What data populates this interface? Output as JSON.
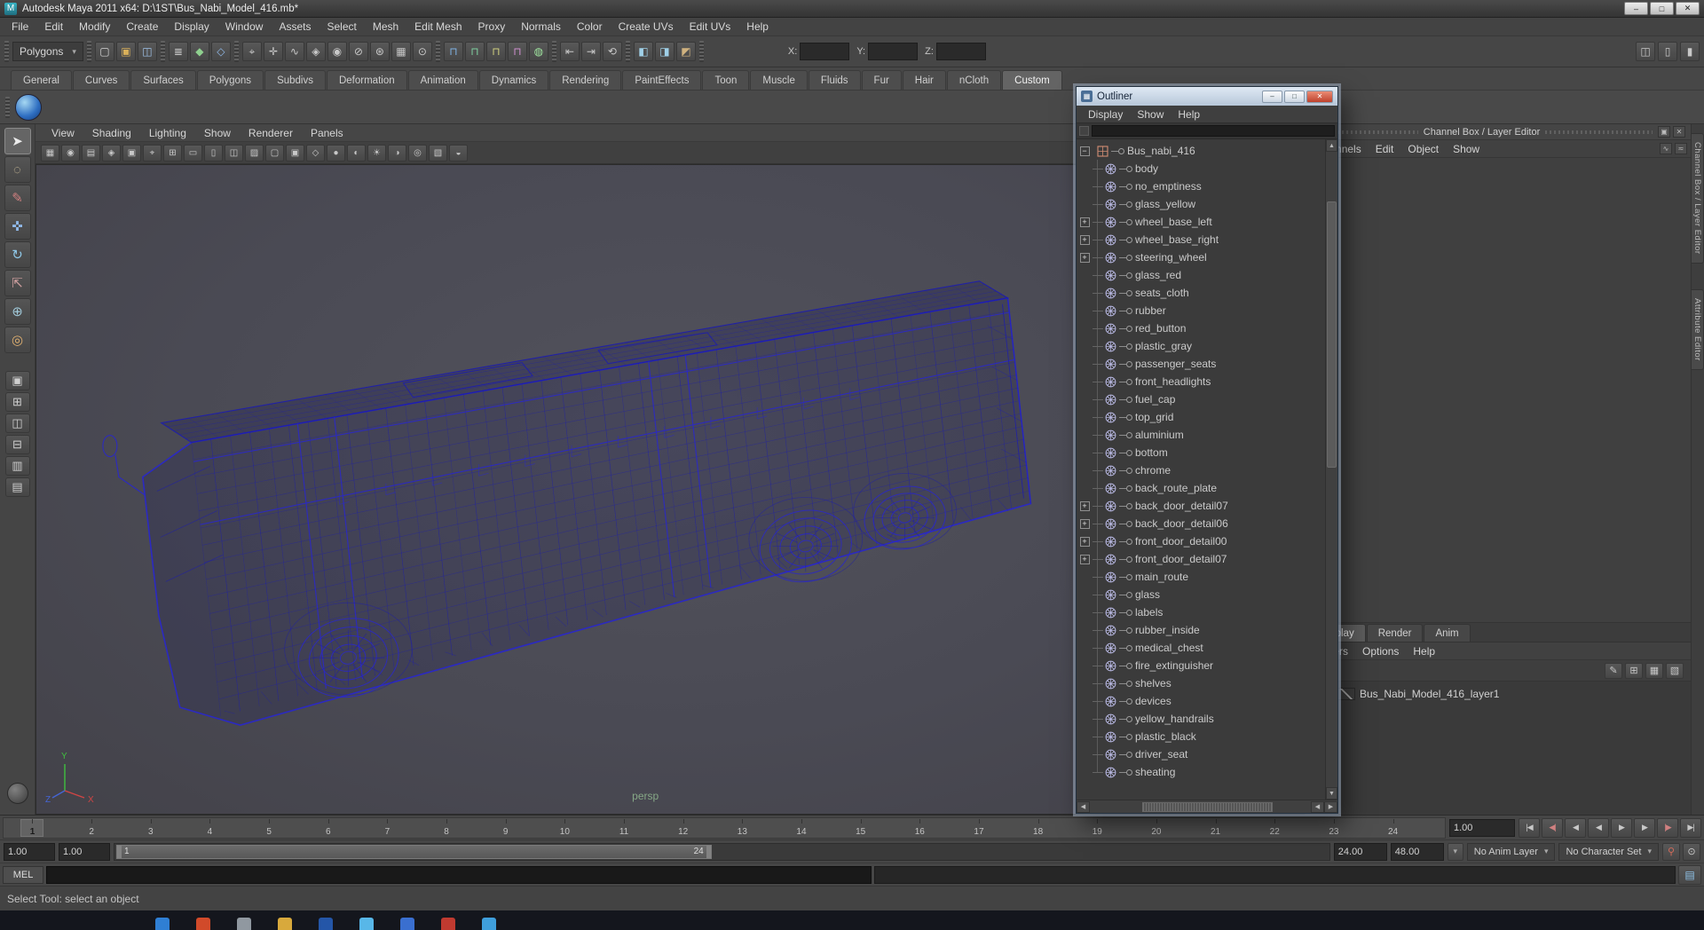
{
  "colors": {
    "wireframe": "#1c1cae",
    "wireframe_bright": "#2a28c8",
    "viewport_bg_center": "#52525c",
    "viewport_bg_edge": "#434249",
    "persp_label_color": "#86a886",
    "axis_x": "#d04545",
    "axis_y": "#3fbf3f",
    "axis_z": "#4565d5",
    "outliner_close_red": "#bf422d"
  },
  "ui": {
    "caret_glyph": "▾"
  },
  "window": {
    "title": "Autodesk Maya 2011 x64: D:\\1ST\\Bus_Nabi_Model_416.mb*",
    "icon_glyph": "M",
    "buttons": [
      {
        "name": "minimize-button",
        "glyph": "–"
      },
      {
        "name": "maximize-button",
        "glyph": "□"
      },
      {
        "name": "close-button",
        "glyph": "✕"
      }
    ]
  },
  "menubar": {
    "items": [
      "File",
      "Edit",
      "Modify",
      "Create",
      "Display",
      "Window",
      "Assets",
      "Select",
      "Mesh",
      "Edit Mesh",
      "Proxy",
      "Normals",
      "Color",
      "Create UVs",
      "Edit UVs",
      "Help"
    ]
  },
  "statusline": {
    "menuset": {
      "value": "Polygons"
    },
    "groups": [
      {
        "name": "file-group",
        "icons": [
          {
            "name": "new-scene-icon",
            "glyph": "▢",
            "color": "#d5d5d5"
          },
          {
            "name": "open-scene-icon",
            "glyph": "▣",
            "color": "#d9b05a"
          },
          {
            "name": "save-scene-icon",
            "glyph": "◫",
            "color": "#9fc2e8"
          }
        ]
      },
      {
        "name": "selection-mode-group",
        "icons": [
          {
            "name": "select-hierarchy-icon",
            "glyph": "≣",
            "color": "#cfcfcf"
          },
          {
            "name": "select-object-icon",
            "glyph": "◆",
            "color": "#8fd08f"
          },
          {
            "name": "select-component-icon",
            "glyph": "◇",
            "color": "#8fb8e8"
          }
        ]
      },
      {
        "name": "selection-mask-group",
        "icons": [
          {
            "name": "select-points-icon",
            "glyph": "⌖"
          },
          {
            "name": "select-handles-icon",
            "glyph": "✛"
          },
          {
            "name": "select-curves-icon",
            "glyph": "∿"
          },
          {
            "name": "select-surfaces-icon",
            "glyph": "◈"
          },
          {
            "name": "select-deformations-icon",
            "glyph": "◉"
          },
          {
            "name": "select-joints-icon",
            "glyph": "⊘"
          },
          {
            "name": "select-dynamics-icon",
            "glyph": "⊛"
          },
          {
            "name": "select-rendering-icon",
            "glyph": "▦"
          },
          {
            "name": "select-misc-icon",
            "glyph": "⊙"
          }
        ]
      },
      {
        "name": "snap-group",
        "icons": [
          {
            "name": "snap-grid-icon",
            "glyph": "⊓",
            "color": "#7fb2e5"
          },
          {
            "name": "snap-curve-icon",
            "glyph": "⊓",
            "color": "#7fd0a0"
          },
          {
            "name": "snap-point-icon",
            "glyph": "⊓",
            "color": "#d0d07f"
          },
          {
            "name": "snap-plane-icon",
            "glyph": "⊓",
            "color": "#d08fd0"
          },
          {
            "name": "make-live-icon",
            "glyph": "◍",
            "color": "#9fe59f"
          }
        ]
      },
      {
        "name": "history-group",
        "icons": [
          {
            "name": "input-connections-icon",
            "glyph": "⇤"
          },
          {
            "name": "output-connections-icon",
            "glyph": "⇥"
          },
          {
            "name": "construction-history-icon",
            "glyph": "⟲"
          }
        ]
      },
      {
        "name": "render-group",
        "icons": [
          {
            "name": "render-current-frame-icon",
            "glyph": "◧",
            "color": "#9fd0e8"
          },
          {
            "name": "ipr-render-icon",
            "glyph": "◨",
            "color": "#9fd0e8"
          },
          {
            "name": "render-settings-icon",
            "glyph": "◩",
            "color": "#d0b27f"
          }
        ]
      }
    ],
    "xyz": {
      "x_label": "X:",
      "y_label": "Y:",
      "z_label": "Z:",
      "x_value": "",
      "y_value": "",
      "z_value": ""
    },
    "right_icons": [
      {
        "name": "toggle-attribute-editor-icon",
        "glyph": "◫"
      },
      {
        "name": "toggle-tool-settings-icon",
        "glyph": "▯"
      },
      {
        "name": "toggle-channel-box-icon",
        "glyph": "▮"
      }
    ]
  },
  "shelf": {
    "tabs": [
      "General",
      "Curves",
      "Surfaces",
      "Polygons",
      "Subdivs",
      "Deformation",
      "Animation",
      "Dynamics",
      "Rendering",
      "PaintEffects",
      "Toon",
      "Muscle",
      "Fluids",
      "Fur",
      "Hair",
      "nCloth",
      "Custom"
    ],
    "active_tab": "Custom",
    "items": [
      {
        "name": "custom-shelf-script-button"
      }
    ]
  },
  "toolbox": {
    "tools": [
      {
        "name": "select-tool",
        "glyph": "➤",
        "color": "#ececec",
        "active": true
      },
      {
        "name": "lasso-select-tool",
        "glyph": "◌",
        "color": "#d8c8a0"
      },
      {
        "name": "paint-select-tool",
        "glyph": "✎",
        "color": "#d08080"
      },
      {
        "name": "move-tool",
        "glyph": "✜",
        "color": "#8fb8e8"
      },
      {
        "name": "rotate-tool",
        "glyph": "↻",
        "color": "#8fc8e8"
      },
      {
        "name": "scale-tool",
        "glyph": "⇱",
        "color": "#d0a0a0"
      },
      {
        "name": "universal-manipulator-tool",
        "glyph": "⊕",
        "color": "#a0c8d8"
      },
      {
        "name": "soft-modification-tool",
        "glyph": "◎",
        "color": "#e0b070"
      }
    ],
    "layouts": [
      {
        "name": "layout-single-persp",
        "glyph": "▣"
      },
      {
        "name": "layout-four-view",
        "glyph": "⊞"
      },
      {
        "name": "layout-persp-outliner",
        "glyph": "◫"
      },
      {
        "name": "layout-persp-graph",
        "glyph": "⊟"
      },
      {
        "name": "layout-hypershade-persp",
        "glyph": "▥"
      },
      {
        "name": "layout-persp-side",
        "glyph": "▤"
      }
    ]
  },
  "panel": {
    "menus": [
      "View",
      "Shading",
      "Lighting",
      "Show",
      "Renderer",
      "Panels"
    ],
    "toolbar_icons": [
      {
        "name": "select-camera-icon",
        "glyph": "▦"
      },
      {
        "name": "lock-camera-icon",
        "glyph": "◉"
      },
      {
        "name": "camera-attributes-icon",
        "glyph": "▤"
      },
      {
        "name": "bookmark-icon",
        "glyph": "◈"
      },
      {
        "name": "image-plane-icon",
        "glyph": "▣"
      },
      {
        "name": "2d-pan-zoom-icon",
        "glyph": "⌖"
      },
      {
        "name": "grid-toggle-icon",
        "glyph": "⊞"
      },
      {
        "name": "film-gate-icon",
        "glyph": "▭"
      },
      {
        "name": "resolution-gate-icon",
        "glyph": "▯"
      },
      {
        "name": "gate-mask-icon",
        "glyph": "◫"
      },
      {
        "name": "field-chart-icon",
        "glyph": "▨"
      },
      {
        "name": "safe-action-icon",
        "glyph": "▢"
      },
      {
        "name": "safe-title-icon",
        "glyph": "▣"
      },
      {
        "name": "wireframe-display-icon",
        "glyph": "◇"
      },
      {
        "name": "smooth-shade-icon",
        "glyph": "●"
      },
      {
        "name": "textured-display-icon",
        "glyph": "◐"
      },
      {
        "name": "lights-icon",
        "glyph": "☀"
      },
      {
        "name": "shadows-icon",
        "glyph": "◑"
      },
      {
        "name": "isolate-select-icon",
        "glyph": "◎"
      },
      {
        "name": "xray-icon",
        "glyph": "▧"
      },
      {
        "name": "exposure-icon",
        "glyph": "◒"
      }
    ],
    "camera_label": "persp",
    "axis_labels": {
      "x": "X",
      "y": "Y",
      "z": "Z"
    }
  },
  "outliner": {
    "title": "Outliner",
    "window_buttons": [
      {
        "name": "outliner-minimize-button",
        "glyph": "–"
      },
      {
        "name": "outliner-maximize-button",
        "glyph": "□"
      },
      {
        "name": "outliner-close-button",
        "glyph": "✕",
        "close": true
      }
    ],
    "menus": [
      "Display",
      "Show",
      "Help"
    ],
    "filter_value": "",
    "scroll_glyphs": {
      "up": "▲",
      "down": "▼",
      "left": "◀",
      "right": "▶"
    },
    "items": [
      {
        "label": "Bus_nabi_416",
        "type": "group",
        "expand": "minus"
      },
      {
        "label": "body",
        "type": "mesh"
      },
      {
        "label": "no_emptiness",
        "type": "mesh"
      },
      {
        "label": "glass_yellow",
        "type": "mesh"
      },
      {
        "label": "wheel_base_left",
        "type": "mesh",
        "expand": "plus"
      },
      {
        "label": "wheel_base_right",
        "type": "mesh",
        "expand": "plus"
      },
      {
        "label": "steering_wheel",
        "type": "mesh",
        "expand": "plus"
      },
      {
        "label": "glass_red",
        "type": "mesh"
      },
      {
        "label": "seats_cloth",
        "type": "mesh"
      },
      {
        "label": "rubber",
        "type": "mesh"
      },
      {
        "label": "red_button",
        "type": "mesh"
      },
      {
        "label": "plastic_gray",
        "type": "mesh"
      },
      {
        "label": "passenger_seats",
        "type": "mesh"
      },
      {
        "label": "front_headlights",
        "type": "mesh"
      },
      {
        "label": "fuel_cap",
        "type": "mesh"
      },
      {
        "label": "top_grid",
        "type": "mesh"
      },
      {
        "label": "aluminium",
        "type": "mesh"
      },
      {
        "label": "bottom",
        "type": "mesh"
      },
      {
        "label": "chrome",
        "type": "mesh"
      },
      {
        "label": "back_route_plate",
        "type": "mesh"
      },
      {
        "label": "back_door_detail07",
        "type": "mesh",
        "expand": "plus"
      },
      {
        "label": "back_door_detail06",
        "type": "mesh",
        "expand": "plus"
      },
      {
        "label": "front_door_detail00",
        "type": "mesh",
        "expand": "plus"
      },
      {
        "label": "front_door_detail07",
        "type": "mesh",
        "expand": "plus"
      },
      {
        "label": "main_route",
        "type": "mesh"
      },
      {
        "label": "glass",
        "type": "mesh"
      },
      {
        "label": "labels",
        "type": "mesh"
      },
      {
        "label": "rubber_inside",
        "type": "mesh"
      },
      {
        "label": "medical_chest",
        "type": "mesh"
      },
      {
        "label": "fire_extinguisher",
        "type": "mesh"
      },
      {
        "label": "shelves",
        "type": "mesh"
      },
      {
        "label": "devices",
        "type": "mesh"
      },
      {
        "label": "yellow_handrails",
        "type": "mesh"
      },
      {
        "label": "plastic_black",
        "type": "mesh"
      },
      {
        "label": "driver_seat",
        "type": "mesh"
      },
      {
        "label": "sheating",
        "type": "mesh"
      }
    ]
  },
  "channelbox": {
    "header": "Channel Box / Layer Editor",
    "header_icons": [
      {
        "name": "channelbox-undock-icon",
        "glyph": "▣"
      },
      {
        "name": "channelbox-close-icon",
        "glyph": "✕"
      }
    ],
    "menus": [
      "Channels",
      "Edit",
      "Object",
      "Show"
    ],
    "menu_icons": [
      {
        "name": "channel-speed-icon",
        "glyph": "∿"
      },
      {
        "name": "channel-manip-icon",
        "glyph": "≂"
      }
    ],
    "layer_tabs": [
      "Display",
      "Render",
      "Anim"
    ],
    "active_layer_tab": "Display",
    "layer_menus": [
      "Layers",
      "Options",
      "Help"
    ],
    "layer_toolbar_icons": [
      {
        "name": "layer-edit-icon",
        "glyph": "✎"
      },
      {
        "name": "layer-new-icon",
        "glyph": "⊞"
      },
      {
        "name": "layer-new-empty-icon",
        "glyph": "▦"
      },
      {
        "name": "layer-new-from-selected-icon",
        "glyph": "▧"
      }
    ],
    "layers": [
      {
        "name": "Bus_Nabi_Model_416_layer1"
      }
    ]
  },
  "sidebar_tabs": [
    {
      "name": "tab-channel-box-layer-editor",
      "label": "Channel Box / Layer Editor"
    },
    {
      "name": "tab-attribute-editor",
      "label": "Attribute Editor"
    }
  ],
  "timeline": {
    "frames": [
      "1",
      "2",
      "3",
      "4",
      "5",
      "6",
      "7",
      "8",
      "9",
      "10",
      "11",
      "12",
      "13",
      "14",
      "15",
      "16",
      "17",
      "18",
      "19",
      "20",
      "21",
      "22",
      "23",
      "24"
    ],
    "current_frame": "1",
    "current_time": "1.00",
    "playback_buttons": [
      {
        "name": "go-to-start-button",
        "glyph": "|◀"
      },
      {
        "name": "step-back-key-button",
        "glyph": "◀|",
        "color": "#d08080"
      },
      {
        "name": "step-back-frame-button",
        "glyph": "◀"
      },
      {
        "name": "play-backwards-button",
        "glyph": "◀"
      },
      {
        "name": "play-forwards-button",
        "glyph": "▶"
      },
      {
        "name": "step-forward-frame-button",
        "glyph": "▶"
      },
      {
        "name": "step-forward-key-button",
        "glyph": "|▶",
        "color": "#d08080"
      },
      {
        "name": "go-to-end-button",
        "glyph": "▶|"
      }
    ]
  },
  "range": {
    "anim_start": "1.00",
    "play_start": "1.00",
    "bar_start_label": "1",
    "bar_end_label": "24",
    "play_end": "24.00",
    "anim_end": "48.00",
    "anim_layer": "No Anim Layer",
    "character_set": "No Character Set",
    "right_buttons": [
      {
        "name": "auto-keyframe-toggle",
        "glyph": "⚲",
        "color": "#d06a5a"
      },
      {
        "name": "animation-preferences-button",
        "glyph": "⊙"
      }
    ]
  },
  "command_line": {
    "mode_label": "MEL",
    "input_value": ""
  },
  "help_line": {
    "text": "Select Tool: select an object"
  },
  "taskbar": {
    "icons": [
      {
        "name": "taskbar-app-icon-1",
        "color": "#2f7fd4"
      },
      {
        "name": "taskbar-app-icon-2",
        "color": "#d14a2a"
      },
      {
        "name": "taskbar-app-icon-3",
        "color": "#9098a0"
      },
      {
        "name": "taskbar-app-icon-4",
        "color": "#d8a93c"
      },
      {
        "name": "taskbar-app-icon-5",
        "color": "#2456a8"
      },
      {
        "name": "taskbar-app-icon-6",
        "color": "#58b7e8"
      },
      {
        "name": "taskbar-app-icon-7",
        "color": "#3a6fd0"
      },
      {
        "name": "taskbar-app-icon-8",
        "color": "#c03a30"
      },
      {
        "name": "taskbar-app-icon-9",
        "color": "#3f9fdc"
      }
    ]
  }
}
